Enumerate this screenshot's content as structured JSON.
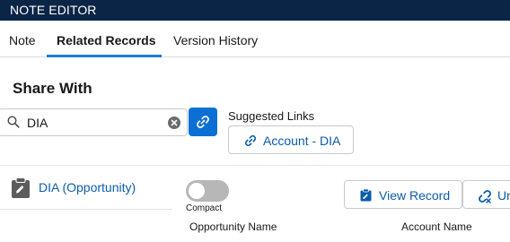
{
  "window": {
    "title": "NOTE EDITOR"
  },
  "tabs": [
    {
      "label": "Note",
      "active": false
    },
    {
      "label": "Related Records",
      "active": true
    },
    {
      "label": "Version History",
      "active": false
    }
  ],
  "share": {
    "heading": "Share With",
    "search_value": "DIA",
    "search_icon": "search-icon",
    "clear_icon": "clear-icon",
    "link_icon": "link-icon",
    "suggested_label": "Suggested Links",
    "suggested_link": "Account - DIA"
  },
  "record": {
    "icon": "clipboard-icon",
    "name": "DIA (Opportunity)",
    "toggle_label": "Compact",
    "toggle_on": false,
    "view_button": "View Record",
    "unlink_button": "Unlink"
  },
  "table": {
    "columns": [
      "Opportunity Name",
      "Account Name"
    ]
  },
  "colors": {
    "titlebar": "#0b2546",
    "accent": "#0b6fd3",
    "link": "#0b5cab",
    "tab_underline": "#1b7bd9"
  }
}
